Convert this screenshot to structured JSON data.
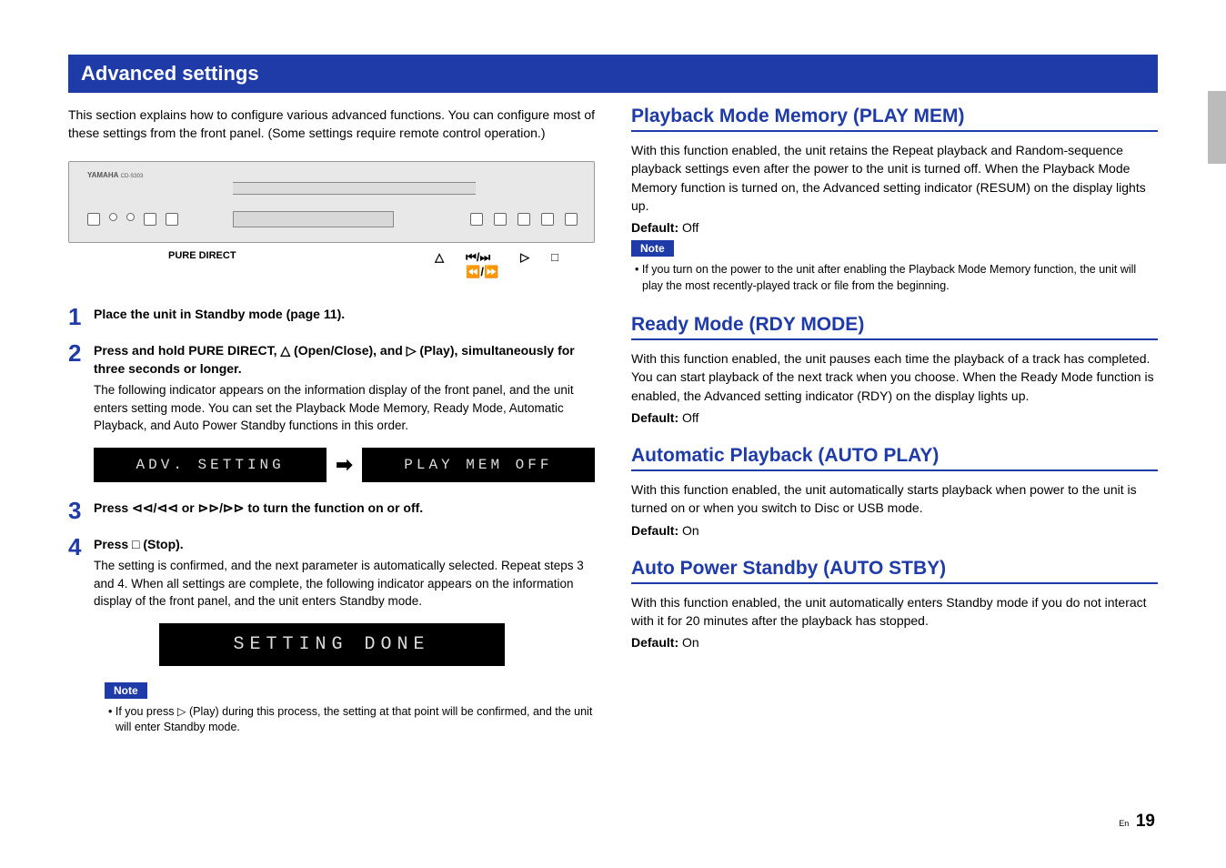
{
  "header": "Advanced settings",
  "intro": "This section explains how to configure various advanced functions. You can configure most of these settings from the front panel. (Some settings require remote control operation.)",
  "device": {
    "brand": "YAMAHA",
    "model": "CD-S303",
    "callout_pure": "PURE DIRECT",
    "callout_eject": "△",
    "callout_skip": "⊲⊲ / ⊳⊳",
    "callout_play": "▷",
    "callout_stop": "□"
  },
  "steps": [
    {
      "num": "1",
      "title": "Place the unit in Standby mode (page 11).",
      "desc": ""
    },
    {
      "num": "2",
      "title": "Press and hold PURE DIRECT, △ (Open/Close), and ▷ (Play), simultaneously for three seconds or longer.",
      "desc": "The following indicator appears on the information display of the front panel, and the unit enters setting mode. You can set the Playback Mode Memory, Ready Mode, Automatic Playback, and Auto Power Standby functions in this order."
    },
    {
      "num": "3",
      "title": "Press ⊲⊲/⊲⊲ or ⊳⊳/⊳⊳ to turn the function on or off.",
      "desc": ""
    },
    {
      "num": "4",
      "title": "Press □ (Stop).",
      "desc": "The setting is confirmed, and the next parameter is automatically selected. Repeat steps 3 and 4. When all settings are complete, the following indicator appears on the information display of the front panel, and the unit enters Standby mode."
    }
  ],
  "lcd1": "ADV. SETTING",
  "lcd2": "PLAY MEM OFF",
  "lcd_done": "SETTING DONE",
  "note_label": "Note",
  "note1": "• If you press ▷ (Play) during this process, the setting at that point will be confirmed, and the unit will enter Standby mode.",
  "sections": [
    {
      "title": "Playback Mode Memory (PLAY MEM)",
      "body": "With this function enabled, the unit retains the Repeat playback and Random-sequence playback settings even after the power to the unit is turned off. When the Playback Mode Memory function is turned on, the Advanced setting indicator (RESUM) on the display lights up.",
      "default_label": "Default:",
      "default_val": "Off",
      "note": "• If you turn on the power to the unit after enabling the Playback Mode Memory function, the unit will play the most recently-played track or file from the beginning."
    },
    {
      "title": "Ready Mode (RDY MODE)",
      "body": "With this function enabled, the unit pauses each time the playback of a track has completed. You can start playback of the next track when you choose. When the Ready Mode function is enabled, the Advanced setting indicator (RDY) on the display lights up.",
      "default_label": "Default:",
      "default_val": "Off"
    },
    {
      "title": "Automatic Playback (AUTO PLAY)",
      "body": "With this function enabled, the unit automatically starts playback when power to the unit is turned on or when you switch to Disc or USB mode.",
      "default_label": "Default:",
      "default_val": "On"
    },
    {
      "title": "Auto Power Standby (AUTO STBY)",
      "body": "With this function enabled, the unit automatically enters Standby mode if you do not interact with it for 20 minutes after the playback has stopped.",
      "default_label": "Default:",
      "default_val": "On"
    }
  ],
  "footer": {
    "lang": "En",
    "page": "19"
  }
}
